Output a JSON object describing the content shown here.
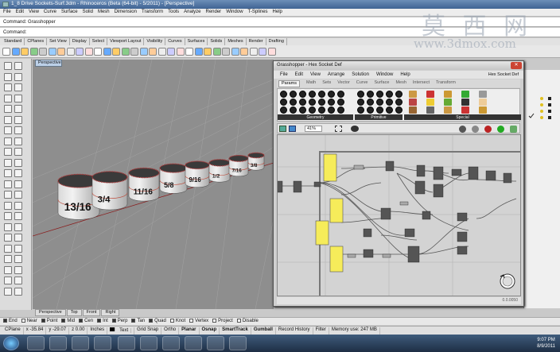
{
  "window": {
    "title": "1_8 Drive Sockets-Surf.3dm - Rhinoceros (Beta (64-bit) - 5/2011) - [Perspective]"
  },
  "menu": [
    "File",
    "Edit",
    "View",
    "Curve",
    "Surface",
    "Solid",
    "Mesh",
    "Dimension",
    "Transform",
    "Tools",
    "Analyze",
    "Render",
    "Window",
    "T-Splines",
    "Help"
  ],
  "command": {
    "history": "Command: Grasshopper",
    "prompt": "Command:"
  },
  "toolbar_tabs": [
    "Standard",
    "CPlanes",
    "Set View",
    "Display",
    "Select",
    "Viewport Layout",
    "Visibility",
    "Curves",
    "Surfaces",
    "Solids",
    "Meshes",
    "Render",
    "Drafting"
  ],
  "viewport": {
    "active_tab": "Perspective",
    "tabs": [
      "Perspective",
      "Top",
      "Front",
      "Right"
    ]
  },
  "sockets": [
    "13/16",
    "3/4",
    "11/16",
    "5/8",
    "9/16",
    "1/2",
    "7/16",
    "3/8"
  ],
  "osnaps": [
    {
      "label": "End",
      "on": true
    },
    {
      "label": "Near",
      "on": false
    },
    {
      "label": "Point",
      "on": true
    },
    {
      "label": "Mid",
      "on": true
    },
    {
      "label": "Cen",
      "on": true
    },
    {
      "label": "Int",
      "on": true
    },
    {
      "label": "Perp",
      "on": true
    },
    {
      "label": "Tan",
      "on": true
    },
    {
      "label": "Quad",
      "on": true
    },
    {
      "label": "Knot",
      "on": false
    },
    {
      "label": "Vertex",
      "on": false
    },
    {
      "label": "Project",
      "on": false
    },
    {
      "label": "Disable",
      "on": false
    }
  ],
  "status": {
    "cplane": "CPlane",
    "x": "x -35.84",
    "y": "y -29.07",
    "z": "z 0.00",
    "units": "Inches",
    "layer": "Text",
    "items": [
      "Grid Snap",
      "Ortho",
      "Planar",
      "Osnap",
      "SmartTrack",
      "Gumball",
      "Record History",
      "Filter",
      "Memory use: 247 MB"
    ]
  },
  "clock": {
    "time": "9:07 PM",
    "date": "8/9/2011"
  },
  "grasshopper": {
    "title": "Grasshopper - Hex Socket Def",
    "menu": [
      "File",
      "Edit",
      "View",
      "Arrange",
      "Solution",
      "Window",
      "Help"
    ],
    "doc": "Hex Socket Def",
    "tabs": [
      "Params",
      "Math",
      "Sets",
      "Vector",
      "Curve",
      "Surface",
      "Mesh",
      "Intersect",
      "Transform"
    ],
    "active_tab": "Params",
    "groups": [
      "Geometry",
      "Primitive",
      "Special"
    ],
    "zoom": "41%",
    "footer": "0.0.0050"
  },
  "watermark": {
    "cn": "莫 西 网",
    "url": "www.3dmox.com"
  }
}
